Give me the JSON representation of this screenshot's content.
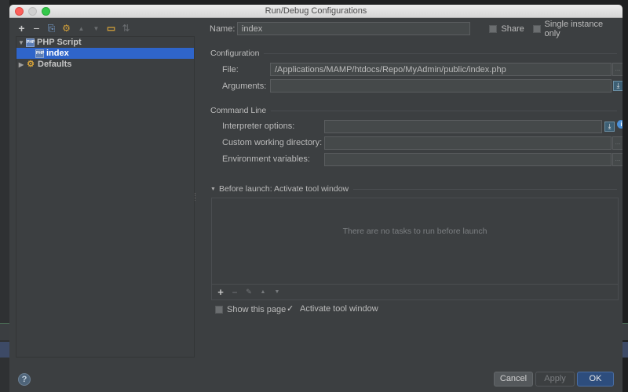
{
  "window": {
    "title": "Run/Debug Configurations"
  },
  "toolbar": {
    "items": [
      {
        "name": "add-icon",
        "glyph": "+"
      },
      {
        "name": "remove-icon",
        "glyph": "−"
      },
      {
        "name": "copy-icon",
        "glyph": "⎘"
      },
      {
        "name": "edit-defaults-icon",
        "glyph": "⚙"
      },
      {
        "name": "move-up-icon",
        "glyph": "▲"
      },
      {
        "name": "move-down-icon",
        "glyph": "▼"
      },
      {
        "name": "folder-icon",
        "glyph": "▭"
      },
      {
        "name": "sort-icon",
        "glyph": "⇅"
      }
    ]
  },
  "tree": {
    "groups": [
      {
        "label": "PHP Script",
        "expanded": true,
        "children": [
          {
            "label": "index",
            "selected": true
          }
        ]
      },
      {
        "label": "Defaults",
        "expanded": false
      }
    ]
  },
  "form": {
    "name_label": "Name:",
    "name_value": "index",
    "share_label": "Share",
    "share_checked": false,
    "single_instance_label": "Single instance only",
    "single_instance_checked": false,
    "configuration_section": "Configuration",
    "file_label": "File:",
    "file_value": "/Applications/MAMP/htdocs/Repo/MyAdmin/public/index.php",
    "arguments_label": "Arguments:",
    "arguments_value": "",
    "command_line_section": "Command Line",
    "interpreter_label": "Interpreter options:",
    "interpreter_value": "",
    "working_dir_label": "Custom working directory:",
    "working_dir_value": "",
    "env_label": "Environment variables:",
    "env_value": "",
    "before_launch_section": "Before launch: Activate tool window",
    "before_launch_empty": "There are no tasks to run before launch",
    "show_page_label": "Show this page",
    "show_page_checked": false,
    "activate_tool_label": "Activate tool window",
    "activate_tool_checked": true
  },
  "buttons": {
    "help": "?",
    "cancel": "Cancel",
    "apply": "Apply",
    "ok": "OK"
  },
  "icons": {
    "browse": "...",
    "expand": "⤓",
    "info": "i",
    "check": "✓",
    "arrow_down": "▼",
    "arrow_right": "▶",
    "gear": "⚙",
    "php": "PHP"
  }
}
